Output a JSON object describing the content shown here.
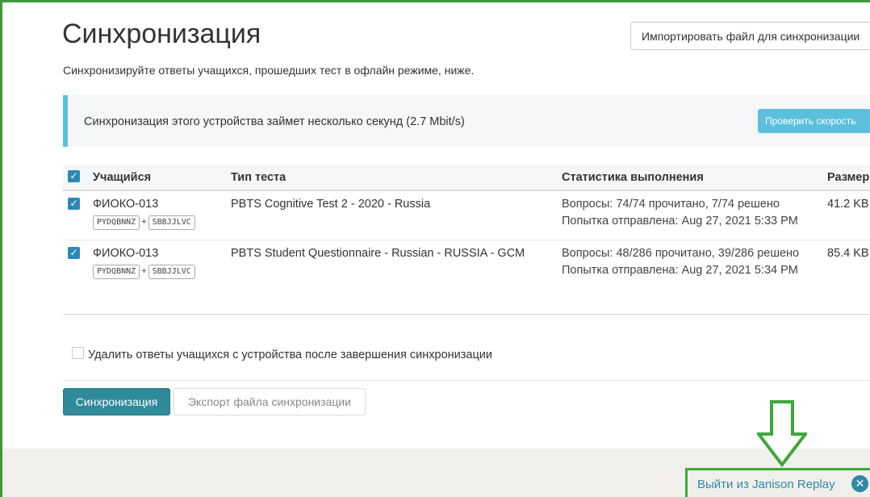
{
  "page": {
    "title": "Синхронизация",
    "subtitle": "Синхронизируйте ответы учащихся, прошедших тест в офлайн режиме, ниже.",
    "import_button": "Импортировать файл для синхронизации"
  },
  "alert": {
    "text": "Синхронизация этого устройства займет несколько секунд (2.7 Mbit/s)",
    "speed_button": "Проверить скорость"
  },
  "table": {
    "headers": {
      "student": "Учащийся",
      "test_type": "Тип теста",
      "stats": "Статистика выполнения",
      "size": "Размер"
    },
    "rows": [
      {
        "student": "ФИОКО-013",
        "code1": "PYDQBNNZ",
        "code2": "SBBJJLVC",
        "plus": "+",
        "test_type": "PBTS Cognitive Test 2 - 2020 - Russia",
        "stats_line1": "Вопросы: 74/74 прочитано, 7/74 решено",
        "stats_line2": "Попытка отправлена: Aug 27, 2021 5:33 PM",
        "size": "41.2 KB",
        "checked": true
      },
      {
        "student": "ФИОКО-013",
        "code1": "PYDQBNNZ",
        "code2": "SBBJJLVC",
        "plus": "+",
        "test_type": "PBTS Student Questionnaire - Russian - RUSSIA - GCM",
        "stats_line1": "Вопросы: 48/286 прочитано, 39/286 решено",
        "stats_line2": "Попытка отправлена: Aug 27, 2021 5:34 PM",
        "size": "85.4 KB",
        "checked": true
      }
    ]
  },
  "delete_option": {
    "label": "Удалить ответы учащихся с устройства после завершения синхронизации",
    "checked": false
  },
  "actions": {
    "sync_button": "Синхронизация",
    "export_button": "Экспорт файла синхронизации"
  },
  "footer": {
    "exit_link": "Выйти из Janison Replay",
    "exit_icon": "close-circle-icon"
  },
  "colors": {
    "accent": "#2f8a9a",
    "info": "#5bc0de",
    "checkbox": "#2e87b5",
    "highlight": "#3da83a",
    "link": "#2e8aa6"
  }
}
